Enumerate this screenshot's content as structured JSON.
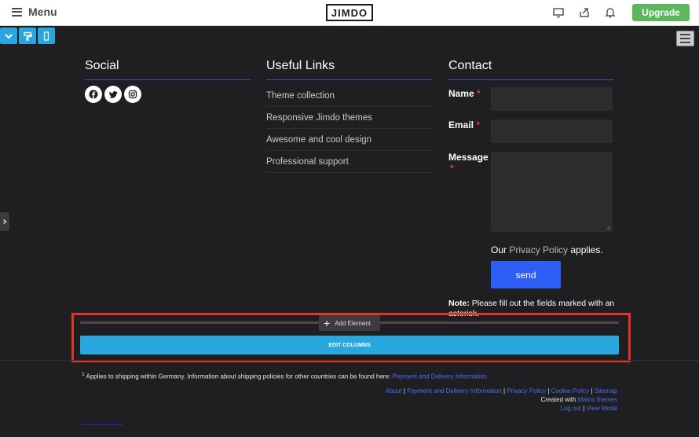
{
  "topbar": {
    "menu_label": "Menu",
    "logo": "JIMDO",
    "upgrade_label": "Upgrade",
    "icons": [
      "desktop-icon",
      "share-icon",
      "bell-icon"
    ]
  },
  "tools": {
    "icons": [
      "chevron-down-icon",
      "paint-roller-icon",
      "mobile-icon"
    ]
  },
  "colors": {
    "accent": "#2aa6df",
    "send": "#2f5ef4",
    "upgrade": "#5cb85c",
    "highlight": "#e5332a"
  },
  "social": {
    "title": "Social",
    "icons": [
      "facebook-icon",
      "twitter-icon",
      "instagram-icon"
    ]
  },
  "links": {
    "title": "Useful Links",
    "items": [
      "Theme collection",
      "Responsive Jimdo themes",
      "Awesome and cool design",
      "Professional support"
    ]
  },
  "contact": {
    "title": "Contact",
    "name_label": "Name",
    "email_label": "Email",
    "message_label": "Message",
    "required_mark": "*",
    "privacy_prefix": "Our",
    "privacy_link": "Privacy Policy",
    "privacy_suffix": "applies.",
    "send_label": "send",
    "note_bold": "Note:",
    "note_text": "Please fill out the fields marked with an asterisk."
  },
  "editor": {
    "add_element_label": "Add Element",
    "edit_columns_label": "EDIT COLUMNS"
  },
  "footer": {
    "footnote_mark": "1",
    "footnote_text": "Applies to shipping within Germany. Information about shipping policies for other countries can be found here:",
    "footnote_link": "Payment and Delivery Information",
    "links": [
      "About",
      "Payment and Delivery Information",
      "Privacy Policy",
      "Cookie Policy",
      "Sitemap"
    ],
    "separator": "|",
    "created_with": "Created with",
    "theme_link": "Matrix themes",
    "logout": "Log out",
    "view_mode": "View Mode"
  }
}
